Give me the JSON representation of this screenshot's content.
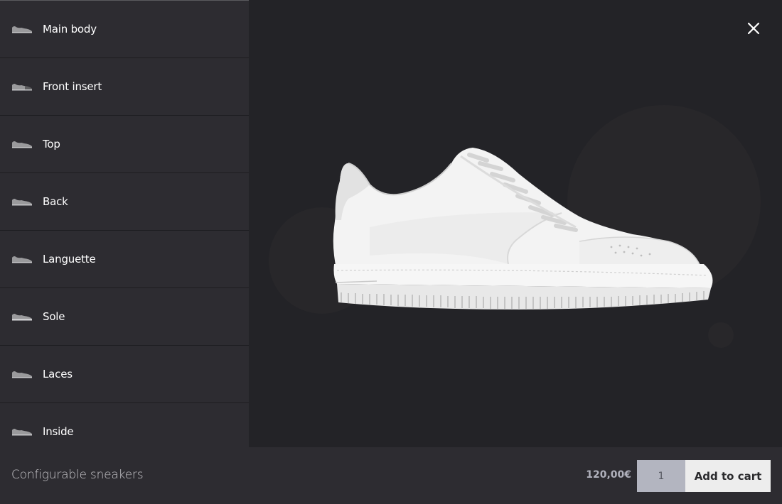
{
  "sidebar": {
    "parts": [
      {
        "label": "Main body",
        "icon": "sneaker-thumbnail-icon"
      },
      {
        "label": "Front insert",
        "icon": "sneaker-thumbnail-icon"
      },
      {
        "label": "Top",
        "icon": "sneaker-thumbnail-icon"
      },
      {
        "label": "Back",
        "icon": "sneaker-thumbnail-icon"
      },
      {
        "label": "Languette",
        "icon": "sneaker-thumbnail-icon"
      },
      {
        "label": "Sole",
        "icon": "sneaker-thumbnail-icon"
      },
      {
        "label": "Laces",
        "icon": "sneaker-thumbnail-icon"
      },
      {
        "label": "Inside",
        "icon": "sneaker-thumbnail-icon"
      }
    ]
  },
  "stage": {
    "close_icon": "close-icon",
    "image_subject": "white low-top sneaker"
  },
  "bottombar": {
    "product_title": "Configurable sneakers",
    "price": "120,00€",
    "quantity": "1",
    "add_to_cart_label": "Add to cart"
  },
  "colors": {
    "sidebar_bg": "#2d2c31",
    "stage_bg": "#232327",
    "button_bg": "#ededed",
    "qty_bg": "#b3b5c0"
  }
}
